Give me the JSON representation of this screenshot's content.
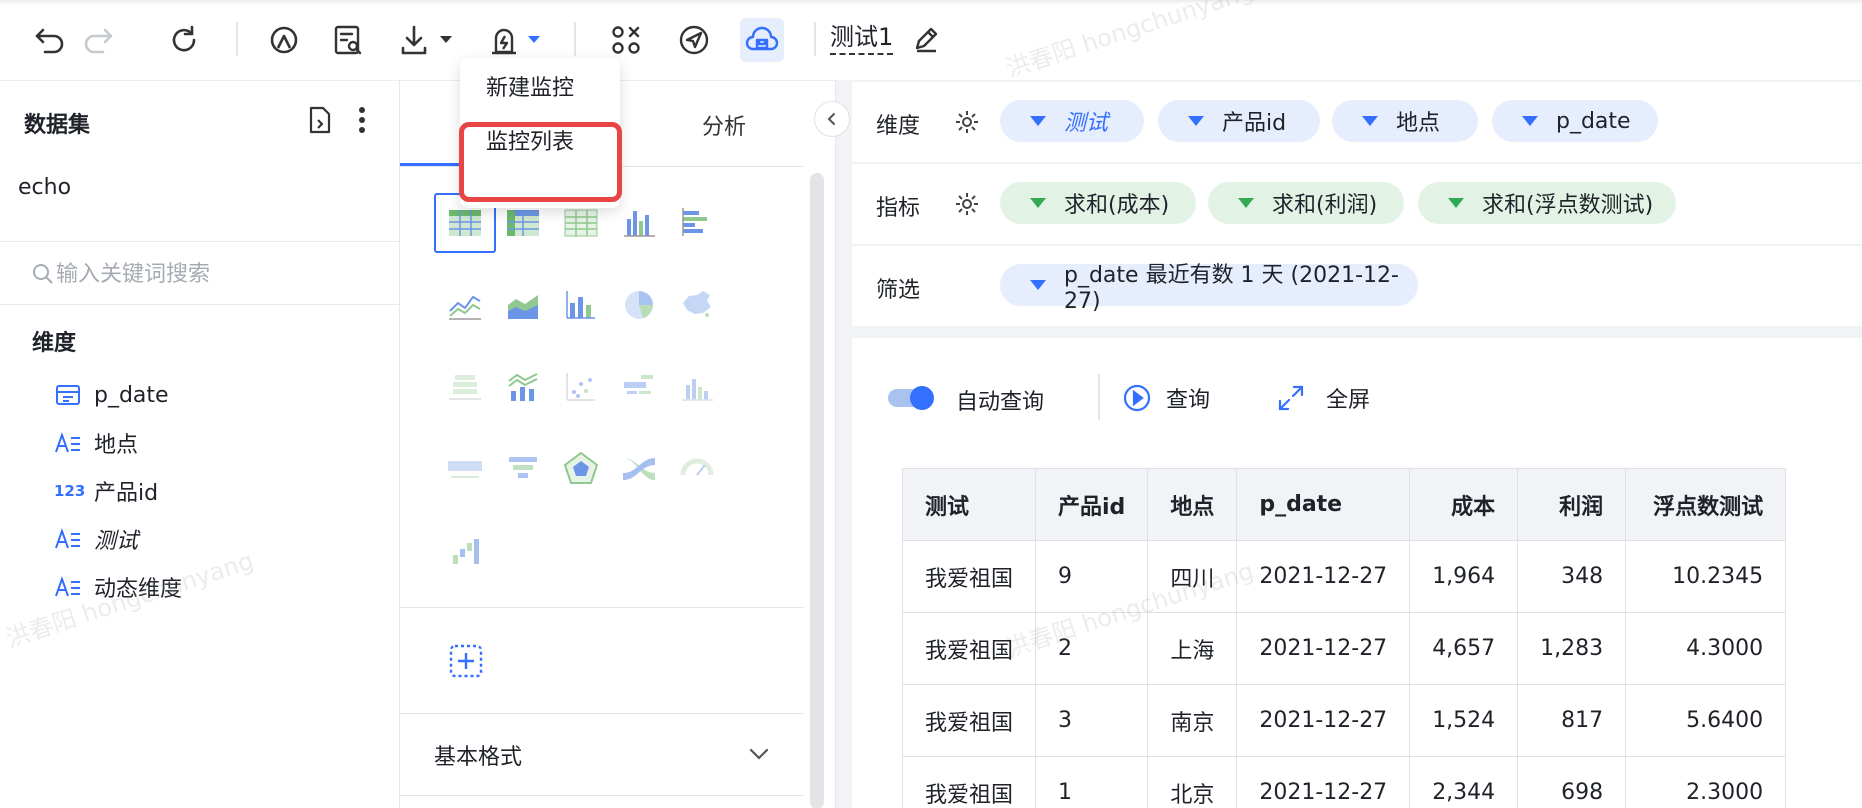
{
  "toolbar": {
    "title": "测试1",
    "icons": [
      "undo-icon",
      "redo-icon",
      "refresh-icon",
      "preview-icon",
      "report-icon",
      "download-icon",
      "alert-icon",
      "components-icon",
      "publish-icon",
      "cloud-save-icon",
      "edit-icon"
    ],
    "accent": "#3370ff"
  },
  "dropdown": {
    "items": [
      "新建监控",
      "监控列表"
    ],
    "highlight_color": "#e84545"
  },
  "left": {
    "title": "数据集",
    "dataset_name": "echo",
    "search_placeholder": "输入关键词搜索",
    "dimension_title": "维度",
    "fields": [
      {
        "icon": "date-icon",
        "label": "p_date"
      },
      {
        "icon": "text-field-icon",
        "label": "地点"
      },
      {
        "icon": "number-field-icon",
        "label": "产品id",
        "icon_text": "123"
      },
      {
        "icon": "text-field-icon",
        "label": "测试"
      },
      {
        "icon": "text-field-icon",
        "label": "动态维度"
      }
    ]
  },
  "middle": {
    "tab_analysis": "分析",
    "basic_format": "基本格式"
  },
  "config": {
    "dimension_label": "维度",
    "dimensions": [
      "测试",
      "产品id",
      "地点",
      "p_date"
    ],
    "metric_label": "指标",
    "metrics": [
      "求和(成本)",
      "求和(利润)",
      "求和(浮点数测试)"
    ],
    "filter_label": "筛选",
    "filters": [
      "p_date 最近有数 1 天 (2021-12-27)"
    ]
  },
  "controls": {
    "auto_query": "自动查询",
    "query": "查询",
    "fullscreen": "全屏"
  },
  "table": {
    "columns": [
      "测试",
      "产品id",
      "地点",
      "p_date",
      "成本",
      "利润",
      "浮点数测试"
    ],
    "rows": [
      [
        "我爱祖国",
        "9",
        "四川",
        "2021-12-27",
        "1,964",
        "348",
        "10.2345"
      ],
      [
        "我爱祖国",
        "2",
        "上海",
        "2021-12-27",
        "4,657",
        "1,283",
        "4.3000"
      ],
      [
        "我爱祖国",
        "3",
        "南京",
        "2021-12-27",
        "1,524",
        "817",
        "5.6400"
      ],
      [
        "我爱祖国",
        "1",
        "北京",
        "2021-12-27",
        "2,344",
        "698",
        "2.3000"
      ]
    ]
  },
  "watermark": "洪春阳 hongchunyang"
}
